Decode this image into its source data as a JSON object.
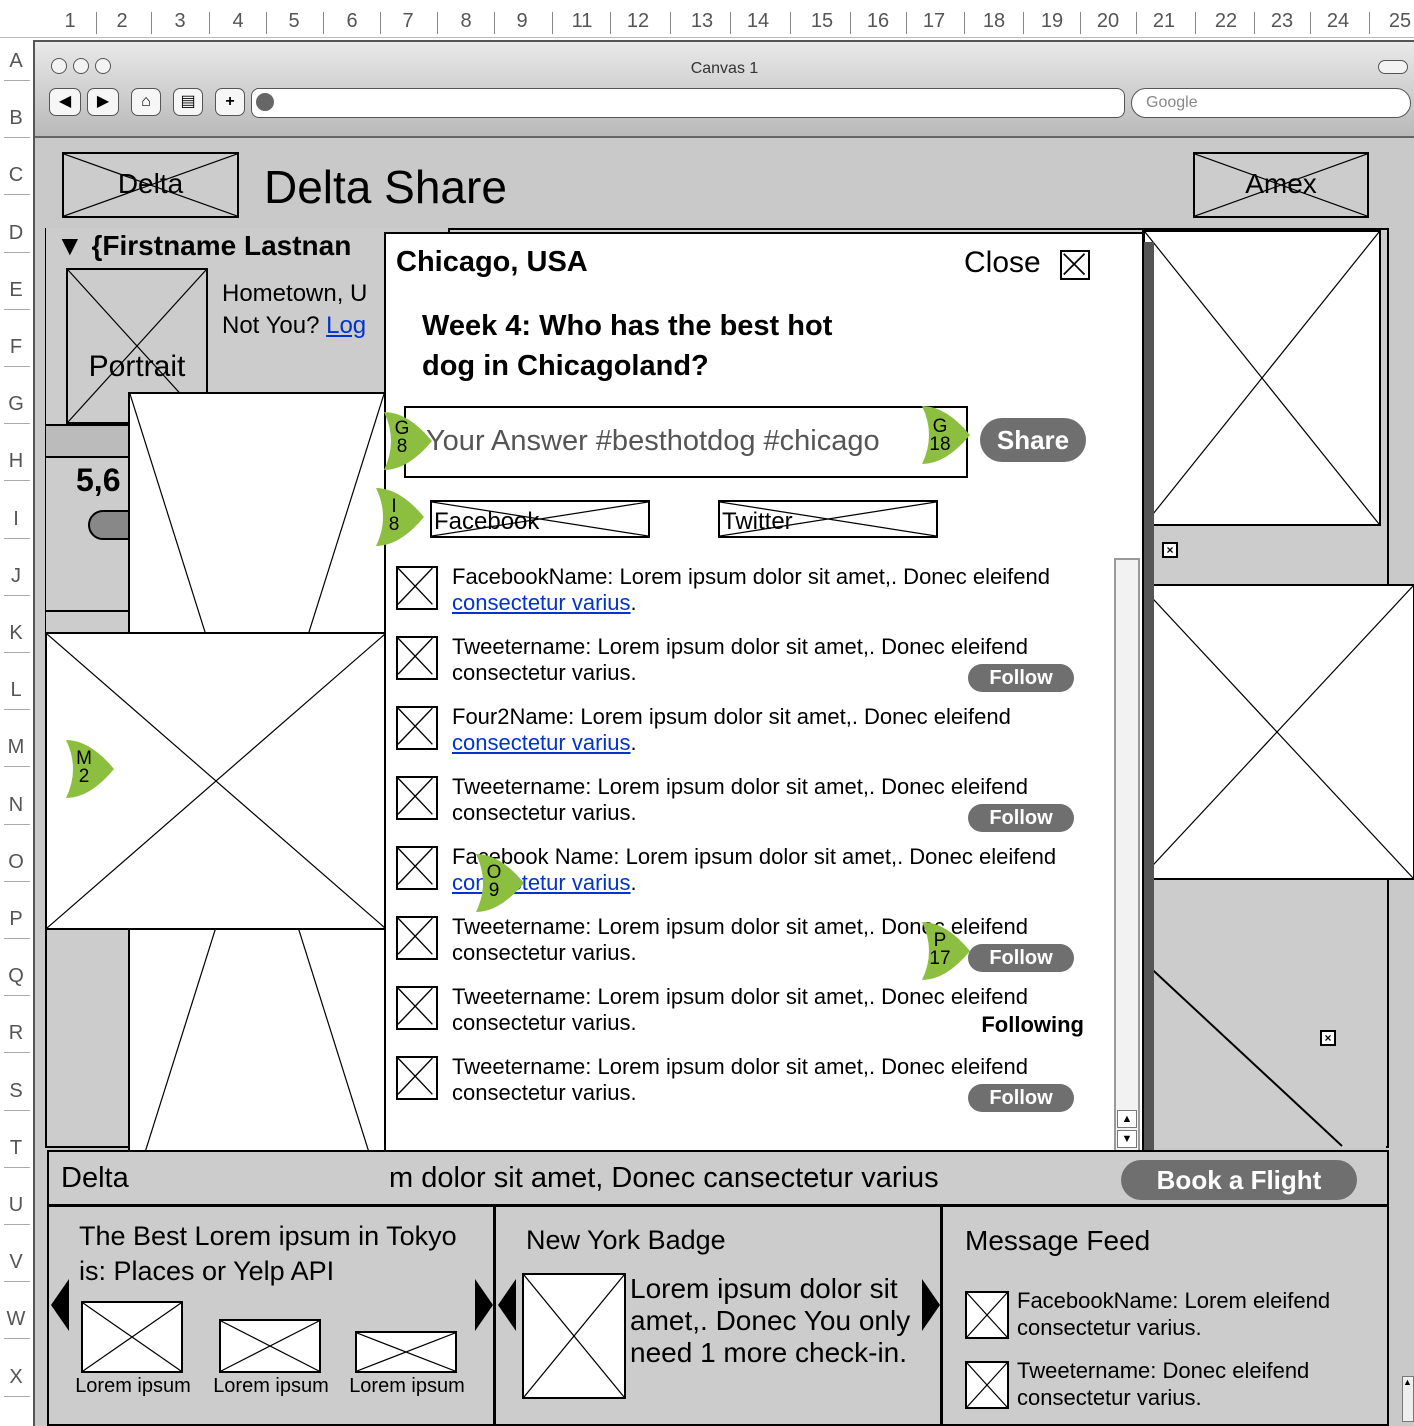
{
  "ruler": {
    "cols": [
      "1",
      "2",
      "3",
      "4",
      "5",
      "6",
      "7",
      "8",
      "9",
      "11",
      "12",
      "13",
      "14",
      "15",
      "16",
      "17",
      "18",
      "19",
      "20",
      "21",
      "22",
      "23",
      "24",
      "25"
    ],
    "rows": [
      "A",
      "B",
      "C",
      "D",
      "E",
      "F",
      "G",
      "H",
      "I",
      "J",
      "K",
      "L",
      "M",
      "N",
      "O",
      "P",
      "Q",
      "R",
      "S",
      "T",
      "U",
      "V",
      "W",
      "X"
    ]
  },
  "browser": {
    "window_title": "Canvas 1",
    "search_placeholder": "Google"
  },
  "header": {
    "left_logo": "Delta",
    "app_title": "Delta Share",
    "right_logo": "Amex"
  },
  "profile": {
    "name": "▼ {Firstname Lastnan",
    "portrait_label": "Portrait",
    "hometown": "Hometown, U",
    "not_you": "Not You?",
    "logout_link": "Log",
    "stat": "5,6"
  },
  "modal": {
    "location": "Chicago, USA",
    "close_label": "Close",
    "question": "Week 4: Who has the best hot dog in Chicagoland?",
    "answer_placeholder": "Your Answer #besthotdog #chicago",
    "share_label": "Share",
    "facebook_label": "Facebook",
    "twitter_label": "Twitter",
    "feed": [
      {
        "text": "FacebookName: Lorem ipsum dolor sit amet,. Donec eleifend ",
        "link": "consectetur varius",
        "after": ".",
        "action": ""
      },
      {
        "text": "Tweetername: Lorem ipsum dolor sit amet,. Donec eleifend consectetur varius.",
        "link": "",
        "after": "",
        "action": "Follow"
      },
      {
        "text": "Four2Name: Lorem ipsum dolor sit amet,. Donec eleifend ",
        "link": "consectetur varius",
        "after": ".",
        "action": ""
      },
      {
        "text": "Tweetername: Lorem ipsum dolor sit amet,. Donec eleifend consectetur varius.",
        "link": "",
        "after": "",
        "action": "Follow"
      },
      {
        "text": "Facebook Name: Lorem ipsum dolor sit amet,. Donec eleifend ",
        "link": "consectetur varius",
        "after": ".",
        "action": ""
      },
      {
        "text": "Tweetername: Lorem ipsum dolor sit amet,. Donec eleifend consectetur varius.",
        "link": "",
        "after": "",
        "action": "Follow"
      },
      {
        "text": "Tweetername: Lorem ipsum dolor sit amet,. Donec eleifend consectetur varius.",
        "link": "",
        "after": "",
        "action": "Following"
      },
      {
        "text": "Tweetername: Lorem ipsum dolor sit amet,. Donec eleifend consectetur varius.",
        "link": "",
        "after": "",
        "action": "Follow"
      }
    ]
  },
  "annotations": {
    "g8": [
      "G",
      "8"
    ],
    "g18": [
      "G",
      "18"
    ],
    "i8": [
      "I",
      "8"
    ],
    "m2": [
      "M",
      "2"
    ],
    "o9": [
      "O",
      "9"
    ],
    "p17": [
      "P",
      "17"
    ]
  },
  "ticker": {
    "text_left": "Delta",
    "text_right": "m dolor sit amet, Donec cansectetur varius",
    "book_label": "Book a Flight"
  },
  "bottom": {
    "tokyo_title": "The Best Lorem ipsum in Tokyo is: Places or Yelp API",
    "tokyo_items": [
      "Lorem ipsum",
      "Lorem ipsum",
      "Lorem ipsum"
    ],
    "badge_title": "New York Badge",
    "badge_text": "Lorem ipsum dolor sit amet,. Donec You only need 1 more check-in.",
    "feed_title": "Message Feed",
    "feed_items": [
      "FacebookName: Lorem eleifend consectetur varius.",
      "Tweetername: Donec eleifend consectetur varius."
    ]
  },
  "colors": {
    "accent_green": "#8cbf3f",
    "link_blue": "#0033cc",
    "pill_gray": "#6f6f6f",
    "canvas_gray": "#c9c9c9"
  }
}
